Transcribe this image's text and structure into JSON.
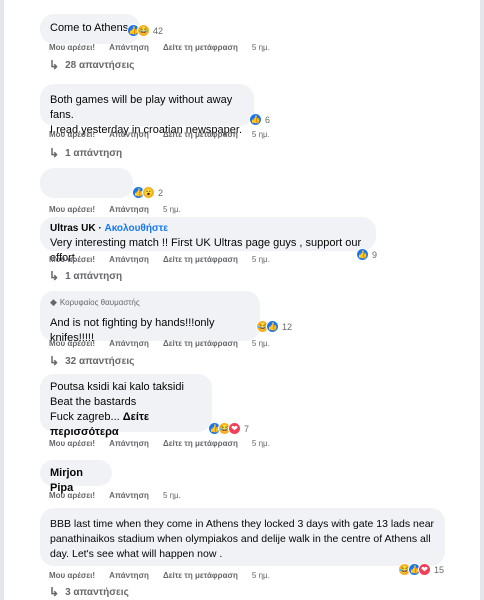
{
  "comments": [
    {
      "text_lines": [
        "Come to Athens"
      ],
      "reaction_count": "42",
      "like_label": "Μου αρέσει!",
      "reply_label": "Απάντηση",
      "translate_label": "Δείτε τη μετάφραση",
      "time": "5 ημ.",
      "replies_label": "28 απαντήσεις"
    },
    {
      "text_lines": [
        "Both games will be play without away fans.",
        "I read yesterday in croatian newspaper."
      ],
      "reaction_count": "6",
      "like_label": "Μου αρέσει!",
      "reply_label": "Απάντηση",
      "translate_label": "Δείτε τη μετάφραση",
      "time": "5 ημ.",
      "replies_label": "1 απάντηση"
    },
    {
      "text_lines": [],
      "reaction_count": "2",
      "like_label": "Μου αρέσει!",
      "reply_label": "Απάντηση",
      "time": "5 ημ."
    },
    {
      "author": "Ultras UK",
      "follow_label": "Ακολουθήστε",
      "text_lines": [
        "Very interesting match !! First UK Ultras page guys , support our effort"
      ],
      "reaction_count": "9",
      "like_label": "Μου αρέσει!",
      "reply_label": "Απάντηση",
      "translate_label": "Δείτε τη μετάφραση",
      "time": "5 ημ.",
      "replies_label": "1 απάντηση"
    },
    {
      "badge": "Κορυφαίος θαυμαστής",
      "text_lines": [
        "And is not fighting by hands!!!only knifes!!!!!"
      ],
      "reaction_count": "12",
      "like_label": "Μου αρέσει!",
      "reply_label": "Απάντηση",
      "translate_label": "Δείτε τη μετάφραση",
      "time": "5 ημ.",
      "replies_label": "32 απαντήσεις"
    },
    {
      "text_lines": [
        "Poutsa ksidi kai kalo taksidi",
        "Beat the bastards",
        "Fuck zagreb..."
      ],
      "see_more": "Δείτε περισσότερα",
      "reaction_count": "7",
      "like_label": "Μου αρέσει!",
      "reply_label": "Απάντηση",
      "translate_label": "Δείτε τη μετάφραση",
      "time": "5 ημ."
    },
    {
      "author": "Mirjon Pipa",
      "like_label": "Μου αρέσει!",
      "reply_label": "Απάντηση",
      "time": "5 ημ."
    },
    {
      "text_lines": [
        "BBB last time when they come in Athens they locked 3 days with gate 13 lads near",
        "panathinaikos stadium when olympiakos and delije walk in the centre of Athens all",
        "day. Let's see what will happen now ."
      ],
      "reaction_count": "15",
      "like_label": "Μου αρέσει!",
      "reply_label": "Απάντηση",
      "translate_label": "Δείτε τη μετάφραση",
      "time": "5 ημ.",
      "replies_label": "3 απαντήσεις"
    }
  ],
  "icons": {
    "like": "like-icon",
    "haha": "haha-icon",
    "wow": "wow-icon",
    "love": "love-icon",
    "reply_arrow": "reply-arrow-icon",
    "badge": "top-fan-icon"
  },
  "colors": {
    "bubble": "#f0f2f5",
    "meta": "#65676b",
    "link": "#1877f2",
    "like": "#1877f2",
    "haha": "#f7b125",
    "love": "#f33e58"
  }
}
